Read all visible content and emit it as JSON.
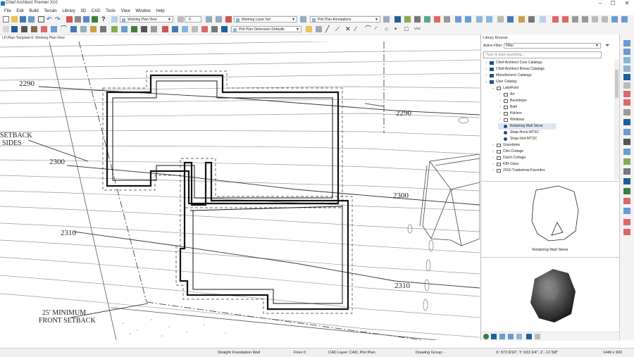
{
  "window": {
    "title": "Chief Architect Premier X10",
    "buttons": [
      "–",
      "☐",
      "✕"
    ]
  },
  "menu": [
    "File",
    "Edit",
    "Build",
    "Terrain",
    "Library",
    "3D",
    "CAD",
    "Tools",
    "View",
    "Window",
    "Help"
  ],
  "toolbar1": {
    "plan_view": "Working Plan View",
    "layer_set": "Working Layer Set",
    "annotations": "Plot Plan Annotations",
    "spin_value": "0"
  },
  "toolbar2": {
    "dimension_defaults": "Plot Plan Dimension Defaults"
  },
  "view_tab": "LP-Plan-Template-6: Working Plan View",
  "drawing": {
    "contours": [
      "2290",
      "2290",
      "2300",
      "2300",
      "2310",
      "2310"
    ],
    "setback_sides": [
      "SETBACK",
      "SIDES"
    ],
    "front_setback": [
      "25' MINIMUM",
      "FRONT SETBACK"
    ]
  },
  "library": {
    "title": "Library Browser",
    "active_filter_label": "Active Filter:",
    "active_filter_value": "Filter",
    "search_placeholder": "Type to start searching...",
    "tree": [
      {
        "label": "Chief Architect Core Catalogs",
        "level": 0,
        "type": "catalog",
        "expanded": false
      },
      {
        "label": "Chief Architect Bonus Catalogs",
        "level": 0,
        "type": "catalog",
        "expanded": false
      },
      {
        "label": "Manufacturer Catalogs",
        "level": 0,
        "type": "catalog",
        "expanded": false
      },
      {
        "label": "User Catalog",
        "level": 0,
        "type": "catalog",
        "expanded": true
      },
      {
        "label": "LakePoint",
        "level": 1,
        "type": "folder",
        "expanded": true
      },
      {
        "label": "Art",
        "level": 2,
        "type": "folder",
        "expanded": false
      },
      {
        "label": "Backdrops",
        "level": 2,
        "type": "folder",
        "expanded": false
      },
      {
        "label": "Bath",
        "level": 2,
        "type": "folder",
        "expanded": false
      },
      {
        "label": "Kitchen",
        "level": 2,
        "type": "folder",
        "expanded": false
      },
      {
        "label": "Windows",
        "level": 2,
        "type": "folder",
        "expanded": false
      },
      {
        "label": "Retaining Wall Stone",
        "level": 2,
        "type": "item",
        "selected": true
      },
      {
        "label": "Strap-Horiz-MTSC",
        "level": 2,
        "type": "item"
      },
      {
        "label": "Strap-Vert-MTSC",
        "level": 2,
        "type": "item"
      },
      {
        "label": "Grandview",
        "level": 1,
        "type": "folder",
        "expanded": false
      },
      {
        "label": "Chic-Cottage",
        "level": 1,
        "type": "folder",
        "expanded": false
      },
      {
        "label": "Dutch-Cottage",
        "level": 1,
        "type": "folder",
        "expanded": false
      },
      {
        "label": "KBI-Class",
        "level": 1,
        "type": "folder",
        "expanded": false
      },
      {
        "label": "2016-Tradeshow-Favorites",
        "level": 1,
        "type": "folder",
        "expanded": false
      }
    ],
    "preview_caption": "Retaining Wall Stone"
  },
  "status": {
    "tool": "Straight Foundation Wall",
    "floor": "Floor 0",
    "layer": "CAD Layer: CAD, Plot Plan",
    "group": "Drawing Group: -",
    "coords": "X: 573 9/16\", Y: 633 3/4\", Z: -12 5/8\"",
    "size": "1449 x 902"
  },
  "colors": {
    "accent": "#1f5f99",
    "toolbar": "#f3f3f3",
    "selection": "#dde7f3",
    "folder": "#1f4f7a"
  }
}
